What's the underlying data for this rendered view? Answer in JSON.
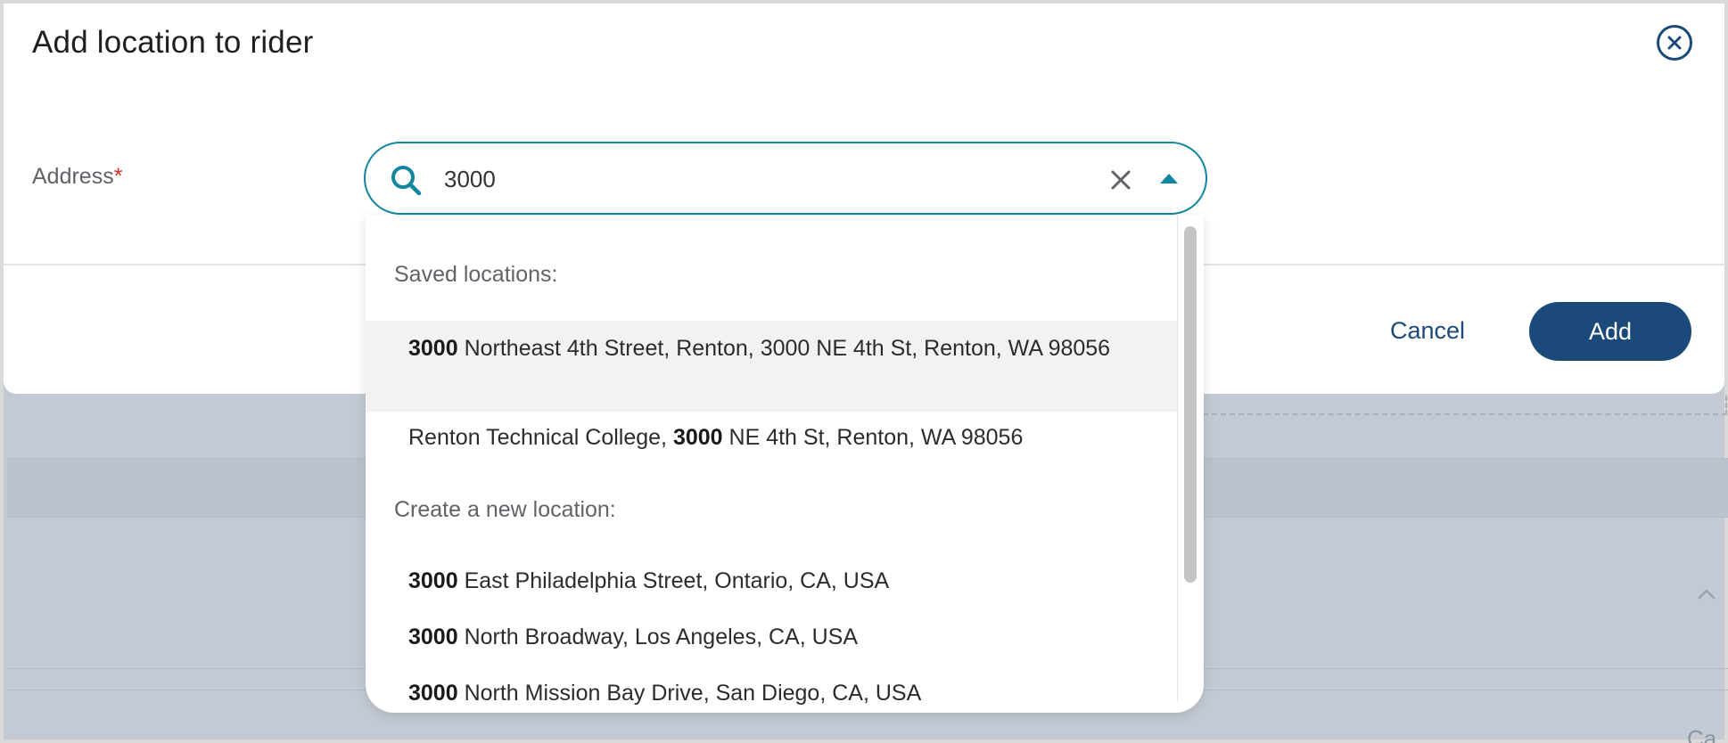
{
  "modal": {
    "title": "Add location to rider",
    "close_icon": "close-circle-icon"
  },
  "address_field": {
    "label": "Address",
    "required_marker": "*",
    "value": "3000",
    "search_icon": "search-icon",
    "clear_icon": "clear-x-icon",
    "toggle_icon": "caret-up-icon"
  },
  "footer": {
    "cancel_label": "Cancel",
    "add_label": "Add"
  },
  "dropdown": {
    "saved_header": "Saved locations:",
    "saved_items": [
      {
        "match": "3000",
        "rest": " Northeast 4th Street, Renton, 3000 NE 4th St, Renton, WA 98056"
      },
      {
        "prefix": "Renton Technical College, ",
        "match": "3000",
        "rest": " NE 4th St, Renton, WA 98056"
      }
    ],
    "new_header": "Create a new location:",
    "new_items": [
      {
        "match": "3000",
        "rest": " East Philadelphia Street, Ontario, CA, USA"
      },
      {
        "match": "3000",
        "rest": " North Broadway, Los Angeles, CA, USA"
      },
      {
        "match": "3000",
        "rest": " North Mission Bay Drive, San Diego, CA, USA"
      }
    ]
  },
  "background": {
    "cut_text": "Ca"
  },
  "colors": {
    "primary": "#1b4a7a",
    "focus_border": "#11869e",
    "required": "#d93025",
    "overlay": "#c4cad4"
  }
}
